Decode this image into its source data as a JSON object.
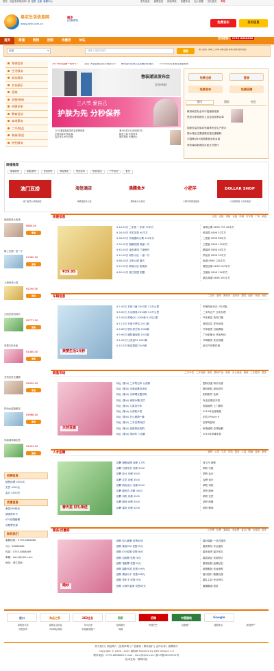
{
  "topbar": {
    "greeting": "您好，欢迎来到易买网! 请",
    "login": "登录",
    "register": "注册",
    "service": "客服中心",
    "links": [
      "发布信息",
      "管理信息",
      "网站导航",
      "收藏本站",
      "加入收藏",
      "设为首页",
      "帮助"
    ]
  },
  "header": {
    "logo_title": "易买生活信息网",
    "logo_url": "www.zjfie.com.cn",
    "city": "丽水",
    "city_switch": "[切换城市]",
    "btn_free": "免费发布",
    "btn_gift": "发布信息"
  },
  "nav": {
    "items": [
      "首页",
      "商铺",
      "购物",
      "团购",
      "优惠券",
      "论坛"
    ],
    "hotline_label": "在线客服:",
    "hotline": "0755-8888888"
  },
  "search": {
    "select_value": "全部",
    "placeholder": "请输入搜索关键字",
    "button": "搜索",
    "hot": "热门搜索: 商铺  二手车  房屋出租  求职  团购  婚纱摄影"
  },
  "sidebar": {
    "items": [
      "车辆信息",
      "生活服务",
      "商务服务",
      "文化娱乐",
      "宠物",
      "房屋/装修",
      "招聘求职",
      "教育培训",
      "本地票务",
      "二手/物品",
      "装修/家居",
      "特色服务"
    ]
  },
  "news_bar": [
    "2015年中国第一带什么?",
    "【热】大型促销活动火爆进行中",
    "教你如何在网上买到最好的宝贝",
    "2015年的元宵最佳搭配推荐"
  ],
  "banner": {
    "top_title": "春装潮流发布会",
    "top_sub": "全场5折起",
    "mid_line1": "三八节 爱自己",
    "mid_line2": "护肤为先 分秒保养",
    "bullets": [
      "2015春装新品发布会重磅来袭",
      "满199减100活动进行中",
      "全场包邮 时尚女装",
      "新品上架 优惠多多",
      "会员专享 积分兑换",
      "限时抢购 大牌低价"
    ]
  },
  "login_box": {
    "btn_free": "免费注册",
    "btn_login": "登录",
    "btn_post": "免费发布",
    "btn_job": "免费招聘",
    "tabs": [
      "国内",
      "国际",
      "社会"
    ],
    "news": [
      "教育局发布全市中招最新政策",
      "恶意欠薪将被列入社会信用黑名单",
      "国家安监总局发布春季安全生产提示",
      "丽水城区主要道路实施交通管制",
      "中国移动4G网络覆盖全部乡镇",
      "养老保险新政四月起正式施行"
    ]
  },
  "shop_rec": {
    "title": "商铺推荐",
    "tabs": [
      "服装服饰",
      "电脑/数码",
      "家具家电",
      "美容美发",
      "食品饮料",
      "旅游/酒店",
      "户外运动",
      "更多"
    ],
    "logos": [
      "澳门豆捞",
      "海信酒店",
      "沸腾鱼乡",
      "小肥羊",
      "DOLLAR SHOP"
    ],
    "captions": [
      "澳门豆捞火锅旗舰店",
      "海豚酒店东大店",
      "沸腾鱼乡北京店",
      "小肥羊涮锅连锁店",
      "沙龙涮锅店《北京城店》"
    ]
  },
  "left_shops": [
    {
      "title": "锦绣家具大卖场",
      "price": "¥680.00",
      "btn": "查看"
    },
    {
      "title": "梅上花园一室一厅",
      "price": "¥1380.00",
      "btn": "查看"
    },
    {
      "title": "上海世茂公寓",
      "price": "¥1290.00",
      "btn": "查看"
    },
    {
      "title": "九阳豆浆机特价",
      "price": "¥2777.00",
      "btn": "查看"
    },
    {
      "title": "苹果手机专卖",
      "price": "¥1480.00",
      "btn": "查看"
    },
    {
      "title": "天然名贵玉器展",
      "price": "¥5639.00",
      "btn": "查看"
    },
    {
      "title": "时尚女装旗舰店",
      "price": "¥3986.00",
      "btn": "查看"
    },
    {
      "title": "华南城商铺出售",
      "price": "¥5434.00",
      "btn": "查看"
    }
  ],
  "sections": [
    {
      "title": "房屋信息",
      "tabs": [
        "出售",
        "出租",
        "求租",
        "合租",
        "商铺",
        "写字楼",
        "厂房",
        "新盘"
      ],
      "img_caption": "¥39.95",
      "list": [
        "¥ 16.00万 二手房 一手房 72平方",
        "¥ 26.00万 天宇名苑 90平方",
        "¥ 58.00万 东城国际公寓 120平方",
        "¥ 32.00万 御景花园 两室一厅",
        "¥ 45.00万 金色港湾 三室两厅",
        "¥ 12.00万 城东小区 一室一厅",
        "¥ 68.00万 中央公园 复式",
        "¥ 22.00万 新城小区 临街房",
        "¥ 80.00万 滨江花园 别墅"
      ],
      "right": [
        "海湾公寓 0898 756 36平方",
        "科技园 0898 52平方",
        "二居室 0898 88平方",
        "三居室 0898 120平方",
        "精装修 0898 46平方",
        "学区房 0898 92平方",
        "临湖 0898 128平方",
        "城西店铺 0898 200平方",
        "江景房 0898 156平方",
        "新区商铺 0898 300平方"
      ]
    },
    {
      "title": "车辆信息",
      "tabs": [
        "二手车",
        "新车",
        "摩托车",
        "自行车",
        "配件",
        "租车",
        "代驾",
        "车险"
      ],
      "img_caption": "美丽生活1元秒",
      "list": [
        "¥ 2.00万 本田飞度 2007款 7.0万公里",
        "¥ 8.00万 大众朗逸 2010款 5.0万公里",
        "¥ 3.50万 奇瑞QQ 2009款 6.0万公里",
        "¥ 12.0万 丰田卡罗拉 2011款",
        "¥ 6.80万 现代伊兰特 2008款",
        "¥ 9.90万 福特福克斯 2010款",
        "¥ 4.20万 比亚迪F3 2009款",
        "¥ 15.0万 别克君越 2009款"
      ],
      "right": [
        "车辆年检代办 7天可取",
        "二手车过户 当天办理",
        "汽车美容 洗车打蜡",
        "驾校招生 学车优惠",
        "汽车租赁 日租周租",
        "广州到丽水 货运专线",
        "代驾服务 安全快捷",
        "武汉汽车配件城"
      ]
    },
    {
      "title": "跳蚤市场",
      "tabs": [
        "二手手机",
        "二手电脑",
        "家电",
        "数码产品",
        "家具",
        "办公用品",
        "服装",
        "二手图书",
        "更多"
      ],
      "img_caption": "天然豆腐",
      "list": [
        "转让 (丽水) 二手笔记本 九成新",
        "转让 (丽水) 天津诺基亚手机",
        "转让 (丽水) 天津理光复印机",
        "转让 (丽水) 家用冰箱 双门",
        "转让 (丽水) 儿童自行车",
        "转让 (丽水) 九成新沙发",
        "转让 (丽水) 办公桌椅一套",
        "转让 (丽水) 二手空调 格力",
        "转让 (丽水) 佳能单反相机",
        "转让 (丽水) 电动车 八成新"
      ],
      "right": [
        "国际快递 特价优惠",
        "数码相机 单反镜头",
        "相机配件 全新",
        "专业回收旧手机",
        "电脑维修 上门服务",
        "2015年出租电脑",
        "手机 iPhone 6",
        "旧家电回收",
        "家电维修 空调加氟",
        "2015年苹果手机"
      ]
    },
    {
      "title": "人才招聘",
      "tabs": [
        "销售",
        "公关",
        "文员",
        "市场",
        "财务",
        "人事",
        "网管",
        "技术",
        "更多"
      ],
      "img_caption": "春天里 好礼相送",
      "list": [
        "招聘 销售经理 月薪 1.5万",
        "招聘 行政专员 月薪 4000",
        "招聘 会计 月薪 5000",
        "招聘 文员 月薪 3500",
        "招聘 网页设计 月薪 6000",
        "招聘 服务员 月薪 3000",
        "招聘 司机 月薪 4500",
        "招聘 厨师 月薪 5500",
        "招聘 保安 月薪 3200"
      ],
      "right": [
        "找工作 销售",
        "求职 行政",
        "求职 会计",
        "应聘 设计",
        "求职 司机",
        "求职 厨师",
        "求职 文员",
        "求职 网管",
        "求职 教师"
      ]
    },
    {
      "title": "票务/优惠券",
      "tabs": [
        "火车票",
        "机票",
        "演唱会",
        "电影票",
        "景点门票",
        "优惠券",
        "更多"
      ],
      "img_caption": "婚纱",
      "list": [
        "团购 双人套餐 仅售68元",
        "团购 美容SPA 仅售99元",
        "团购 KTV欢唱 仅售58元",
        "团购 自助餐 仅售78元",
        "团购 电影票 仅售35元",
        "团购 摄影写真 仅售199元",
        "团购 健身月卡 仅售188元",
        "团购 洗车卡 仅售29元",
        "团购 火锅代金券 仅售80元"
      ],
      "right": [
        "婚纱摄影 一站式服务",
        "婚庆策划 专业团队",
        "婚车租赁 豪华车队",
        "婚宴酒店 优惠预订",
        "婚戒定制 品牌钻石",
        "新娘跟妆 化妆造型",
        "蜜月旅行 套餐优惠",
        "婚礼主持 专业司仪",
        "喜糖喜酒 批发"
      ]
    }
  ],
  "left_lower": {
    "title1": "招聘信息",
    "jobs": [
      "销售经理 5000元",
      "文员 3000元",
      "会计 4500元"
    ],
    "title2": "优惠信息",
    "deals": [
      "美容SPA特价",
      "健身房年卡",
      "KTV欢唱套餐",
      "自助餐优惠"
    ],
    "title3": "联系我们",
    "contacts": [
      "客服热线：0755-8888888",
      "QQ：88888888",
      "传真：0755-8888889",
      "邮箱：ebuy@zjfie.com",
      "地址：浙江丽水"
    ]
  },
  "partners": {
    "logos": [
      "宏川",
      "淘品之家",
      "263企业",
      "抓虾",
      "招聘",
      "中国建筑",
      "Google"
    ],
    "links": [
      "易购官方店",
      "易购生活信息",
      "360云盘",
      "招商银行",
      "阿里巴巴",
      "百度推广",
      "搜狐焦点",
      "新浪房产",
      "凤凰资讯",
      "360网址导航",
      "中国建设银行",
      "网易"
    ]
  },
  "footer": {
    "links": "关于我们 | 网站简介 | 免责声明 | 广告服务 | 联系我们 | 合作伙伴 | 诚聘英才",
    "copyright": "Copyright © 2006 - 2015 易购网 Powered by Zjfie Version 1.0",
    "info": "联系电话：0755-8888888 E-mail：ebuy@zjfie.com 浙ICP备08000001号",
    "icp": "技术支持：易购科技"
  }
}
